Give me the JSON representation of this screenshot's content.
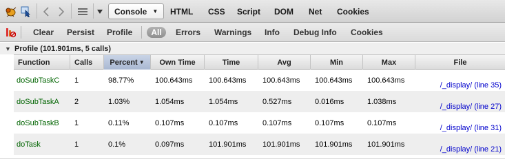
{
  "toolbar": {
    "icons": {
      "firebug": "firebug-icon",
      "inspect": "inspect-cursor-icon",
      "back": "chevron-left-icon",
      "forward": "chevron-right-icon",
      "menu": "list-menu-icon",
      "dropdown": "caret-down-icon"
    },
    "tabs": [
      {
        "label": "Console",
        "selected": true
      },
      {
        "label": "HTML"
      },
      {
        "label": "CSS"
      },
      {
        "label": "Script"
      },
      {
        "label": "DOM"
      },
      {
        "label": "Net"
      },
      {
        "label": "Cookies"
      }
    ]
  },
  "filterbar": {
    "clear_icon": "clear-console-icon",
    "buttons": [
      "Clear",
      "Persist",
      "Profile"
    ],
    "filters": [
      {
        "label": "All",
        "active": true
      },
      {
        "label": "Errors"
      },
      {
        "label": "Warnings"
      },
      {
        "label": "Info"
      },
      {
        "label": "Debug Info"
      },
      {
        "label": "Cookies"
      }
    ]
  },
  "profile": {
    "title": "Profile (101.901ms, 5 calls)",
    "columns": [
      "Function",
      "Calls",
      "Percent",
      "Own Time",
      "Time",
      "Avg",
      "Min",
      "Max",
      "File"
    ],
    "sorted_column": "Percent",
    "rows": [
      {
        "function": "doSubTaskC",
        "calls": "1",
        "percent": "98.77%",
        "own_time": "100.643ms",
        "time": "100.643ms",
        "avg": "100.643ms",
        "min": "100.643ms",
        "max": "100.643ms",
        "file": "/_display/ (line 35)"
      },
      {
        "function": "doSubTaskA",
        "calls": "2",
        "percent": "1.03%",
        "own_time": "1.054ms",
        "time": "1.054ms",
        "avg": "0.527ms",
        "min": "0.016ms",
        "max": "1.038ms",
        "file": "/_display/ (line 27)"
      },
      {
        "function": "doSubTaskB",
        "calls": "1",
        "percent": "0.11%",
        "own_time": "0.107ms",
        "time": "0.107ms",
        "avg": "0.107ms",
        "min": "0.107ms",
        "max": "0.107ms",
        "file": "/_display/ (line 31)"
      },
      {
        "function": "doTask",
        "calls": "1",
        "percent": "0.1%",
        "own_time": "0.097ms",
        "time": "101.901ms",
        "avg": "101.901ms",
        "min": "101.901ms",
        "max": "101.901ms",
        "file": "/_display/ (line 21)"
      }
    ]
  },
  "colors": {
    "function_text": "#006400",
    "file_link": "#0000cc",
    "sorted_header": "#a9b8d2"
  }
}
